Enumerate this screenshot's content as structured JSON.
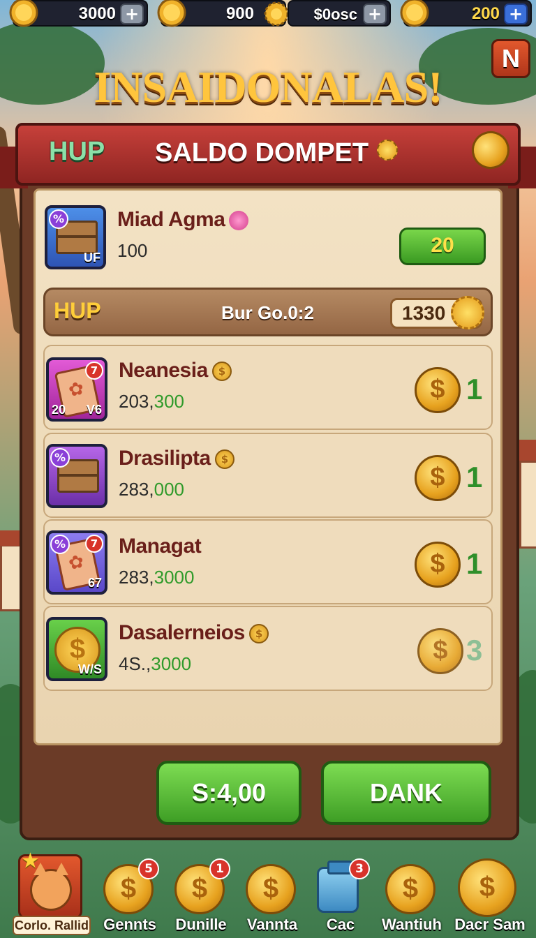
{
  "topbar": {
    "res1": {
      "value": "3000",
      "plus": "+",
      "icon": "gold-coin-icon"
    },
    "res2": {
      "value": "900",
      "icon": "gold-coin-icon",
      "gear_icon": "gear-coin-icon"
    },
    "res3": {
      "value": "$0osc",
      "plus": "+"
    },
    "res4": {
      "value": "200",
      "plus": "+",
      "icon": "gold-coin-icon"
    }
  },
  "corner_button": "N",
  "game_title": "INSAIDONALAS!",
  "banner": {
    "left": "HUP",
    "title": "SALDO DOMPET"
  },
  "featured": {
    "name": "Miad Agma",
    "amount": "100",
    "icon_tag": "UF",
    "button": "20"
  },
  "hup_bar": {
    "label": "HUP",
    "middle": "Bur Go.0:2",
    "value": "1330"
  },
  "items": [
    {
      "name": "Neanesia",
      "amount_black": "203,",
      "amount_green": "300",
      "reward": "1",
      "icon_left": "20",
      "icon_right": "V6",
      "badge": "7"
    },
    {
      "name": "Drasilipta",
      "amount_black": "283,",
      "amount_green": "000",
      "reward": "1"
    },
    {
      "name": "Managat",
      "amount_black": "283,",
      "amount_green": "3000",
      "reward": "1",
      "icon_tag": "67",
      "badge": "7"
    },
    {
      "name": "Dasalerneios",
      "amount_black": "4S.,",
      "amount_green": "3000",
      "reward": "3",
      "icon_tag": "W/S"
    }
  ],
  "buttons": {
    "left": "S:4,00",
    "right": "DANK"
  },
  "nav": [
    {
      "label": "Corlo. Rallid"
    },
    {
      "label": "Gennts",
      "badge": "5"
    },
    {
      "label": "Dunille",
      "badge": "1"
    },
    {
      "label": "Vannta"
    },
    {
      "label": "Cac",
      "badge": "3"
    },
    {
      "label": "Wantiuh"
    },
    {
      "label": "Dacr Sam"
    }
  ],
  "colors": {
    "accent_green": "#3a9a22",
    "banner_red": "#c6403a",
    "gold": "#ffc53d"
  }
}
